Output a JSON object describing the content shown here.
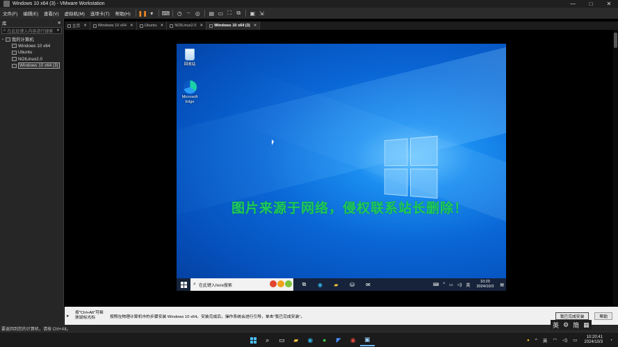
{
  "window": {
    "title": "Windows 10 x64 (3) - VMware Workstation",
    "controls": [
      "—",
      "□",
      "✕"
    ]
  },
  "menubar": {
    "items": [
      "文件(F)",
      "编辑(E)",
      "查看(V)",
      "虚拟机(M)",
      "选项卡(T)",
      "帮助(H)"
    ]
  },
  "library": {
    "title": "库",
    "close": "✕",
    "search_placeholder": "在此处键入内容进行搜索",
    "root": "我的计算机",
    "vms": [
      "Windows 10 x64",
      "Ubuntu",
      "NOILinux2.0",
      "Windows 10 x64 (3)"
    ]
  },
  "tabs": [
    {
      "label": "主页"
    },
    {
      "label": "Windows 10 x64"
    },
    {
      "label": "Ubuntu"
    },
    {
      "label": "NOILinux2.0"
    },
    {
      "label": "Windows 10 x64 (3)",
      "active": true
    }
  ],
  "guest": {
    "icons": [
      {
        "label": "回收站",
        "icon": "recycle-bin-icon"
      },
      {
        "label": "Microsoft Edge",
        "icon": "edge-icon"
      }
    ],
    "watermark": "图片来源于网络，侵权联系站长删除！",
    "taskbar": {
      "search_placeholder": "在此键入here搜索",
      "tray_lang": "英",
      "time": "10:20",
      "date": "2024/10/3"
    }
  },
  "hint": {
    "ctrl_alt_text": "按\"Ctrl+Alt\"可释放鼠标光标",
    "message": "按照在物理计算机中的步骤安装 Windows 10 x64。安装完成后，操作系统会进行引导，单击\"我已完成安装\"。",
    "done_button": "我已完成安装",
    "help_button": "帮助"
  },
  "statusbar": {
    "text": "要返回到您的计算机，请按 Ctrl+Alt。"
  },
  "ime": [
    "英",
    "⚙",
    "简"
  ],
  "host_taskbar": {
    "tray_lang": "英",
    "time": "10:20:41",
    "date": "2024/10/3"
  },
  "colors": {
    "accent_orange": "#f08a24",
    "watermark_green": "#1ecb5a",
    "desktop_blue": "#0a67d6"
  }
}
